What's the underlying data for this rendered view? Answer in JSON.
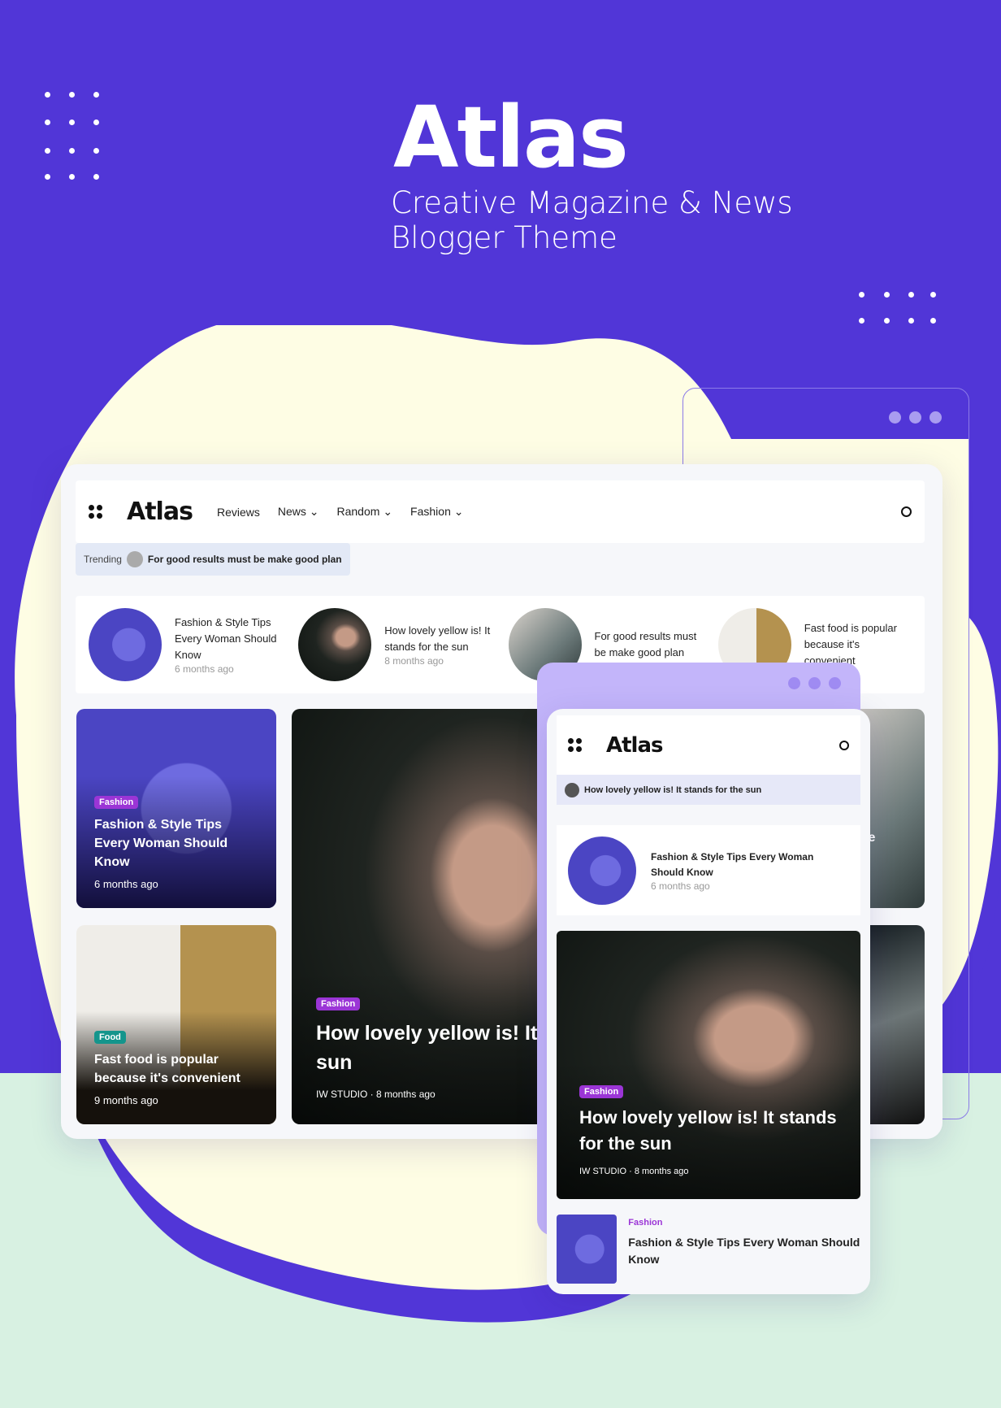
{
  "promo": {
    "brand": "Atlas",
    "subtitle_line1": "Creative Magazine & News",
    "subtitle_line2": "Blogger Theme"
  },
  "colors": {
    "background": "#5136D7",
    "blob": "#FEFDE4",
    "mint": "#D8F1E2",
    "accent": "#4F4AE0",
    "fashion_tag": "#9B35D6",
    "food_tag": "#14958C",
    "mobile_frame": "#C3B5FA"
  },
  "desktop": {
    "logo": "Atlas",
    "nav": [
      {
        "label": "Reviews",
        "dropdown": false
      },
      {
        "label": "News",
        "dropdown": true
      },
      {
        "label": "Random",
        "dropdown": true
      },
      {
        "label": "Fashion",
        "dropdown": true
      }
    ],
    "trending_label": "Trending",
    "trending_text": "For good results must be make good plan",
    "strip": [
      {
        "title": "Fashion & Style Tips Every Woman Should Know",
        "time": "6 months ago"
      },
      {
        "title": "How lovely yellow is! It stands for the sun",
        "time": "8 months ago"
      },
      {
        "title": "For good results must be make good plan",
        "time": ""
      },
      {
        "title": "Fast food is popular because it's convenient",
        "time": ""
      }
    ],
    "cards": [
      {
        "tag": "Fashion",
        "title": "Fashion & Style Tips Every Woman Should Know",
        "time": "6 months ago"
      },
      {
        "tag": "Food",
        "title": "Fast food is popular because it's convenient",
        "time": "9 months ago"
      }
    ],
    "hero": {
      "tag": "Fashion",
      "title": "How lovely yellow is! It sun",
      "author": "IW STUDIO",
      "time": "8 months ago"
    },
    "right_partial": "st be"
  },
  "mobile": {
    "logo": "Atlas",
    "trending_text": "How lovely yellow is! It stands for the sun",
    "strip": {
      "title": "Fashion & Style Tips Every Woman Should Know",
      "time": "6 months ago"
    },
    "hero": {
      "tag": "Fashion",
      "title": "How lovely yellow is! It stands for the sun",
      "author": "IW STUDIO",
      "time": "8 months ago"
    },
    "list": {
      "tag": "Fashion",
      "title": "Fashion & Style Tips Every Woman Should Know"
    }
  }
}
